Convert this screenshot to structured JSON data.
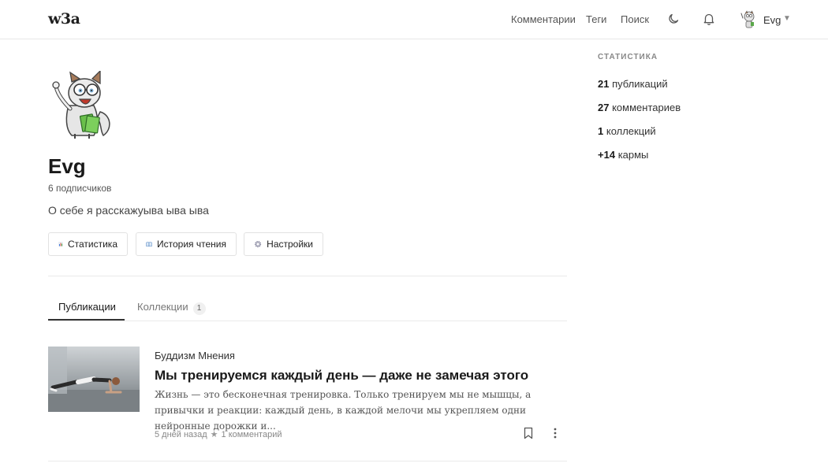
{
  "header": {
    "logo": "w3a",
    "nav": {
      "comments": "Комментарии",
      "tags": "Теги",
      "search": "Поиск"
    },
    "user": {
      "name": "Evg",
      "caret": "▼"
    }
  },
  "profile": {
    "name": "Evg",
    "followers": "6 подписчиков",
    "bio": "О себе я расскажуыва ыва ыва",
    "buttons": {
      "stats": "Статистика",
      "history": "История чтения",
      "settings": "Настройки"
    }
  },
  "tabs": {
    "publications": "Публикации",
    "collections": "Коллекции",
    "collections_count": "1"
  },
  "post": {
    "tags": "Буддизм Мнения",
    "title": "Мы тренируемся каждый день — даже не замечая этого",
    "excerpt": "Жизнь — это бесконечная тренировка. Только тренируем мы не мышцы, а привычки и реакции: каждый день, в каждой мелочи мы укрепляем одни нейронные дорожки и...",
    "time": "5 дней назад",
    "star": "★",
    "comments": "1 комментарий"
  },
  "sidebar": {
    "title": "СТАТИСТИКА",
    "stats": [
      {
        "value": "21",
        "label": "публикаций"
      },
      {
        "value": "27",
        "label": "комментариев"
      },
      {
        "value": "1",
        "label": "коллекций"
      },
      {
        "value": "+14",
        "label": "кармы"
      }
    ]
  },
  "icons": {
    "theme": "moon-icon",
    "notifications": "bell-icon",
    "bookmark": "bookmark-icon",
    "more": "more-vertical-icon"
  }
}
